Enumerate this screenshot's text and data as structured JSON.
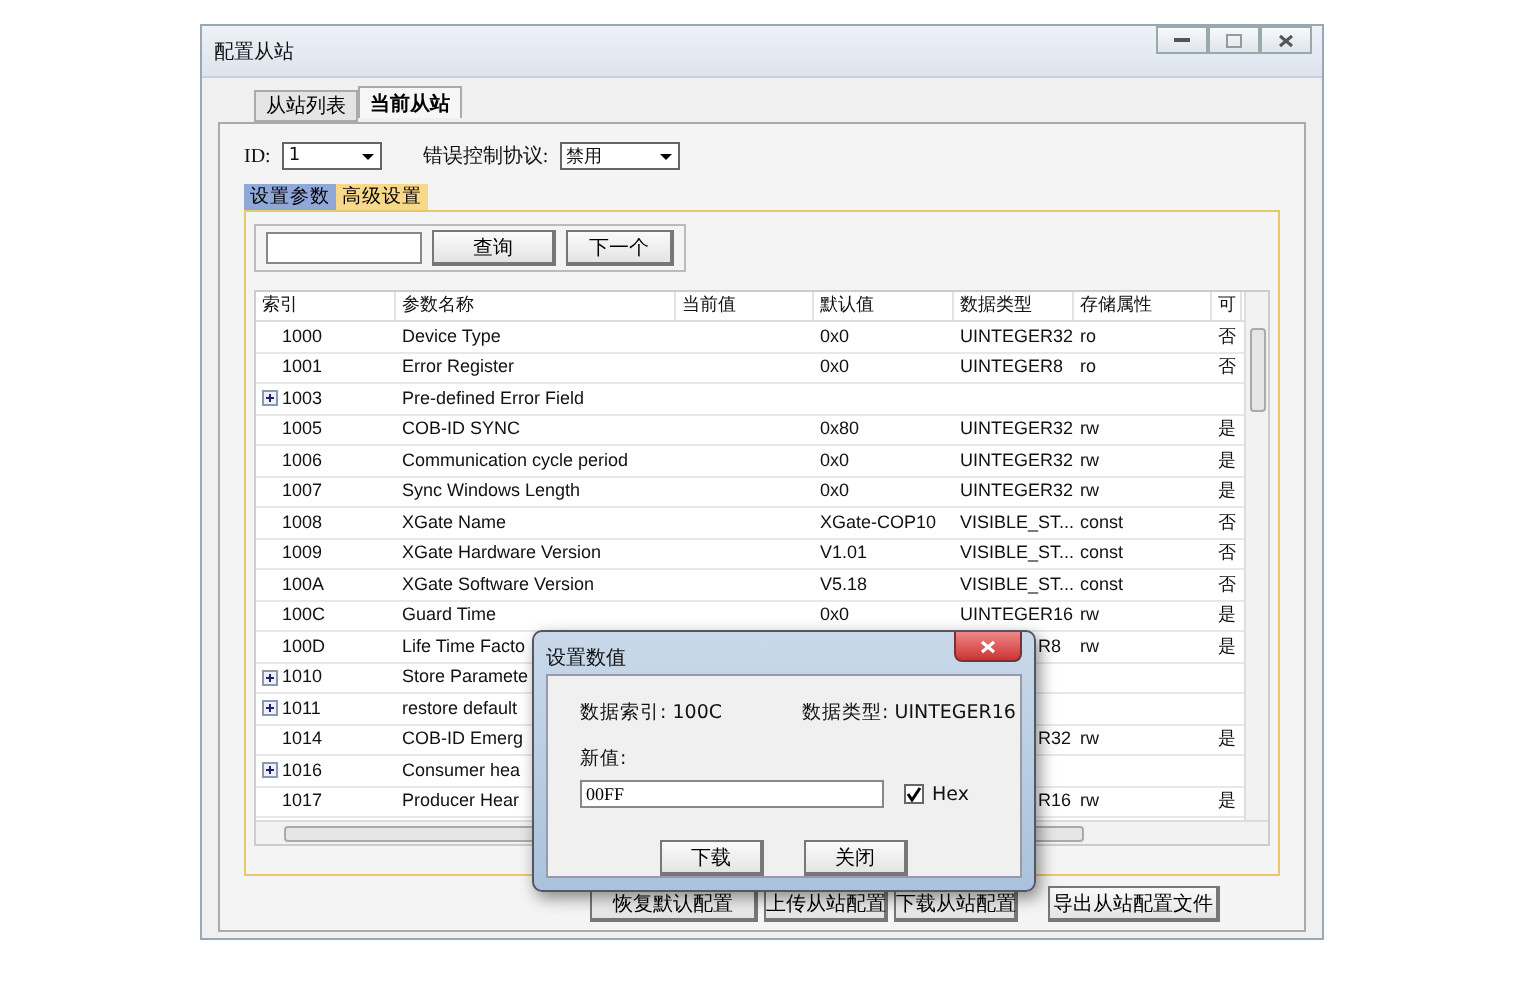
{
  "window": {
    "title": "配置从站"
  },
  "tabs": [
    {
      "label": "从站列表",
      "selected": false
    },
    {
      "label": "当前从站",
      "selected": true
    }
  ],
  "id_field": {
    "label": "ID:",
    "value": "1"
  },
  "protocol_field": {
    "label": "错误控制协议:",
    "value": "禁用"
  },
  "sub_tabs": [
    {
      "label": "设置参数",
      "selected": false
    },
    {
      "label": "高级设置",
      "selected": true
    }
  ],
  "search": {
    "buttons": [
      "查询",
      "下一个"
    ]
  },
  "table": {
    "columns": [
      "索引",
      "参数名称",
      "当前值",
      "默认值",
      "数据类型",
      "存储属性",
      "可"
    ],
    "rows": [
      {
        "expandable": false,
        "covered": false,
        "cells": [
          "1000",
          "Device Type",
          "",
          "0x0",
          "UINTEGER32",
          "ro",
          "否"
        ]
      },
      {
        "expandable": false,
        "covered": false,
        "cells": [
          "1001",
          "Error Register",
          "",
          "0x0",
          "UINTEGER8",
          "ro",
          "否"
        ]
      },
      {
        "expandable": true,
        "covered": false,
        "cells": [
          "1003",
          "Pre-defined Error Field",
          "",
          "",
          "",
          "",
          ""
        ]
      },
      {
        "expandable": false,
        "covered": false,
        "cells": [
          "1005",
          "COB-ID SYNC",
          "",
          "0x80",
          "UINTEGER32",
          "rw",
          "是"
        ]
      },
      {
        "expandable": false,
        "covered": false,
        "cells": [
          "1006",
          "Communication cycle period",
          "",
          "0x0",
          "UINTEGER32",
          "rw",
          "是"
        ]
      },
      {
        "expandable": false,
        "covered": false,
        "cells": [
          "1007",
          "Sync Windows Length",
          "",
          "0x0",
          "UINTEGER32",
          "rw",
          "是"
        ]
      },
      {
        "expandable": false,
        "covered": false,
        "cells": [
          "1008",
          "XGate Name",
          "",
          "XGate-COP10",
          "VISIBLE_ST...",
          "const",
          "否"
        ]
      },
      {
        "expandable": false,
        "covered": false,
        "cells": [
          "1009",
          "XGate Hardware Version",
          "",
          "V1.01",
          "VISIBLE_ST...",
          "const",
          "否"
        ]
      },
      {
        "expandable": false,
        "covered": false,
        "cells": [
          "100A",
          "XGate Software Version",
          "",
          "V5.18",
          "VISIBLE_ST...",
          "const",
          "否"
        ]
      },
      {
        "expandable": false,
        "covered": false,
        "cells": [
          "100C",
          "Guard Time",
          "",
          "0x0",
          "UINTEGER16",
          "rw",
          "是"
        ]
      },
      {
        "expandable": false,
        "covered": true,
        "cells": [
          "100D",
          "Life Time Facto",
          "",
          "",
          "R8",
          "rw",
          "是"
        ]
      },
      {
        "expandable": true,
        "covered": true,
        "cells": [
          "1010",
          "Store Paramete",
          "",
          "",
          "",
          "",
          ""
        ]
      },
      {
        "expandable": true,
        "covered": true,
        "cells": [
          "1011",
          "restore default",
          "",
          "",
          "",
          "",
          ""
        ]
      },
      {
        "expandable": false,
        "covered": true,
        "cells": [
          "1014",
          "COB-ID Emerg",
          "",
          "",
          "R32",
          "rw",
          "是"
        ]
      },
      {
        "expandable": true,
        "covered": true,
        "cells": [
          "1016",
          "Consumer hea",
          "",
          "",
          "",
          "",
          ""
        ]
      },
      {
        "expandable": false,
        "covered": true,
        "cells": [
          "1017",
          "Producer Hear",
          "",
          "",
          "R16",
          "rw",
          "是"
        ]
      }
    ]
  },
  "footer_buttons": [
    "恢复默认配置",
    "上传从站配置",
    "下载从站配置",
    "导出从站配置文件"
  ],
  "dialog": {
    "title": "设置数值",
    "index_label": "数据索引:",
    "index_value": "100C",
    "type_label": "数据类型:",
    "type_value": "UINTEGER16",
    "new_value_label": "新值:",
    "new_value": "00FF",
    "hex": {
      "label": "Hex",
      "checked": true
    },
    "buttons": [
      "下载",
      "关闭"
    ]
  }
}
